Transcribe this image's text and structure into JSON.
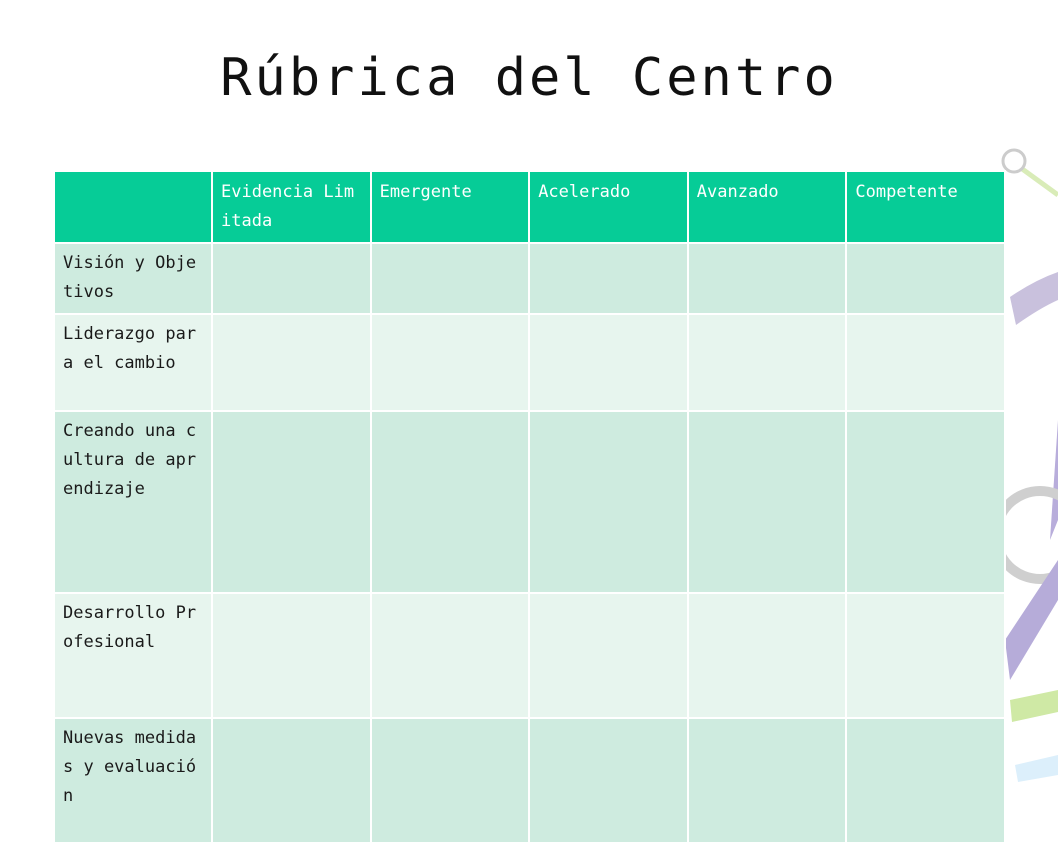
{
  "slide": {
    "title": "Rúbrica del Centro"
  },
  "table": {
    "headers": [
      "",
      "Evidencia Limitada",
      "Emergente",
      "Acelerado",
      "Avanzado",
      "Competente"
    ],
    "rows": [
      {
        "label": "Visión y Objetivos",
        "cells": [
          "",
          "",
          "",
          "",
          ""
        ]
      },
      {
        "label": "Liderazgo para el cambio",
        "cells": [
          "",
          "",
          "",
          "",
          ""
        ]
      },
      {
        "label": "Creando una cultura de aprendizaje",
        "cells": [
          "",
          "",
          "",
          "",
          ""
        ]
      },
      {
        "label": "Desarrollo Profesional",
        "cells": [
          "",
          "",
          "",
          "",
          ""
        ]
      },
      {
        "label": "Nuevas medidas y evaluación",
        "cells": [
          "",
          "",
          "",
          "",
          ""
        ]
      }
    ]
  },
  "colors": {
    "header": "#06cc97",
    "row_dark": "#ceebdf",
    "row_light": "#e7f5ee",
    "decor_purple": "#c9c1dd",
    "decor_green": "#d9ecb8"
  }
}
